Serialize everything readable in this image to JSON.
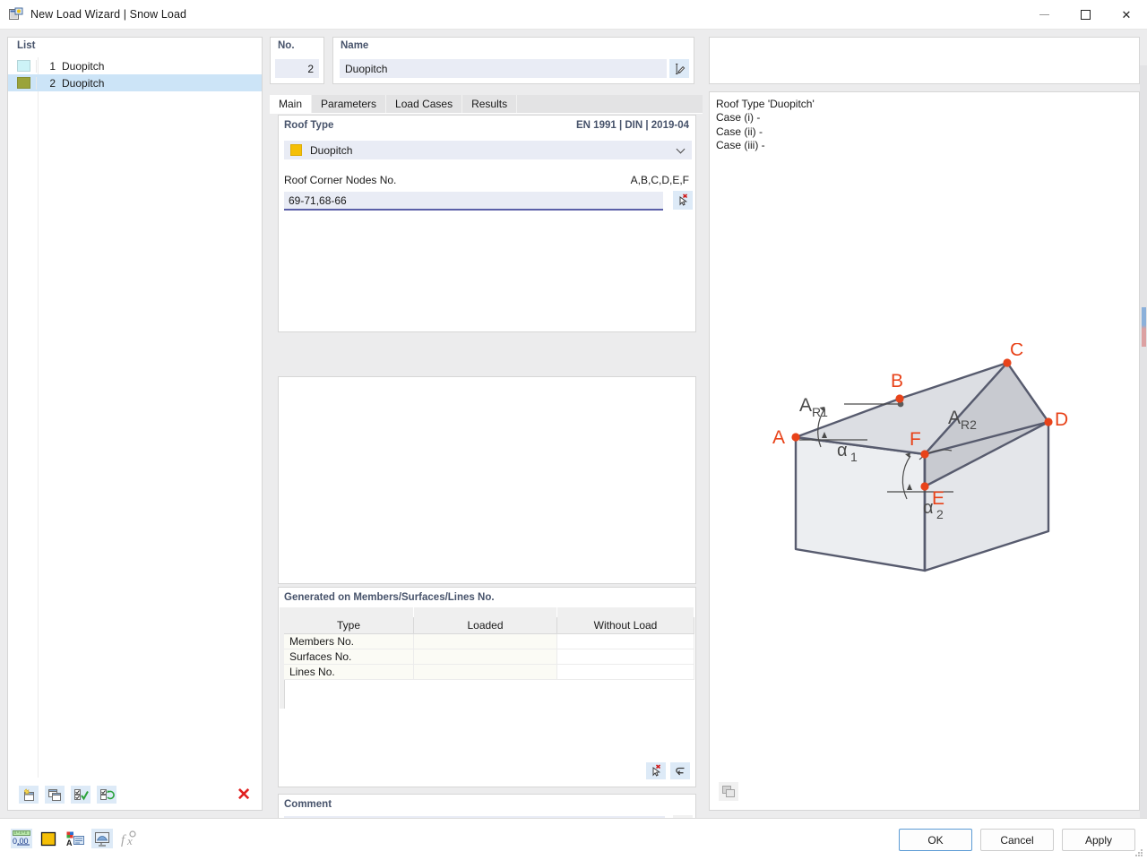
{
  "window": {
    "title": "New Load Wizard | Snow Load",
    "icon": "wizard-icon",
    "minimize": "—",
    "maximize": "□",
    "close": "✕"
  },
  "list": {
    "header": "List",
    "rows": [
      {
        "num": "1",
        "label": "Duopitch",
        "color": "#cdf3f7"
      },
      {
        "num": "2",
        "label": "Duopitch",
        "color": "#9aa33a",
        "selected": true
      }
    ],
    "toolbar": [
      {
        "name": "new-item-button",
        "icon": "new-window-icon"
      },
      {
        "name": "copy-item-button",
        "icon": "copy-window-icon"
      },
      {
        "name": "check-all-button",
        "icon": "checkbox-check-icon"
      },
      {
        "name": "invert-check-button",
        "icon": "checkbox-refresh-icon"
      },
      {
        "name": "delete-item-button",
        "icon": "red-x-icon",
        "glyph": "✕"
      }
    ]
  },
  "header": {
    "no_legend": "No.",
    "no_value": "2",
    "name_legend": "Name",
    "name_value": "Duopitch",
    "edit_button_icon": "edit-pencil-icon"
  },
  "tabs": [
    {
      "label": "Main",
      "active": true
    },
    {
      "label": "Parameters",
      "active": false
    },
    {
      "label": "Load Cases",
      "active": false
    },
    {
      "label": "Results",
      "active": false
    }
  ],
  "roof_type": {
    "legend": "Roof Type",
    "standard": "EN 1991 | DIN | 2019-04",
    "selected": "Duopitch",
    "swatch_color": "#f5bf06",
    "nodes_label": "Roof Corner Nodes No.",
    "nodes_hint": "A,B,C,D,E,F",
    "nodes_value": "69-71,68-66",
    "pick_button_icon": "select-cursor-icon"
  },
  "generated": {
    "legend": "Generated on Members/Surfaces/Lines No.",
    "columns": [
      "Type",
      "Loaded",
      "Without Load"
    ],
    "rows": [
      {
        "type": "Members No.",
        "loaded": "",
        "without_load": ""
      },
      {
        "type": "Surfaces No.",
        "loaded": "",
        "without_load": ""
      },
      {
        "type": "Lines No.",
        "loaded": "",
        "without_load": ""
      }
    ],
    "footer_buttons": [
      {
        "name": "select-cursor-button",
        "icon": "select-cursor-icon"
      },
      {
        "name": "reset-button",
        "icon": "undo-arrow-icon"
      }
    ]
  },
  "comment": {
    "legend": "Comment",
    "value": "",
    "button_icon": "comment-list-icon"
  },
  "right_panel": {
    "info_lines": [
      "Roof Type 'Duopitch'",
      "Case (i) -",
      "Case (ii) -",
      "Case (iii) -"
    ],
    "image_button_icon": "image-copy-icon",
    "diagram": {
      "title": "duopitch-roof-diagram",
      "node_labels": [
        "A",
        "B",
        "C",
        "D",
        "E",
        "F"
      ],
      "area_labels": [
        "A",
        "R1",
        "A",
        "R2"
      ],
      "area_label_1": "A",
      "area_sub_1": "R1",
      "area_label_2": "A",
      "area_sub_2": "R2",
      "angle_1": "α",
      "angle_1_sub": "1",
      "angle_2": "α",
      "angle_2_sub": "2",
      "node_color": "#e8431a",
      "edge_color": "#575b6e",
      "face_light": "#eceef1",
      "face_dark": "#c8cad0",
      "face_mid": "#dcdee3"
    }
  },
  "bottom_toolbar": [
    {
      "name": "units-button",
      "icon": "ruler-000-icon",
      "label": "0,00"
    },
    {
      "name": "color-button",
      "icon": "yellow-square-icon"
    },
    {
      "name": "display-props-button",
      "icon": "palette-panel-icon"
    },
    {
      "name": "view-button",
      "icon": "monitor-icon"
    },
    {
      "name": "formula-button",
      "icon": "fx-icon",
      "label": "fƒ"
    }
  ],
  "dialog_buttons": {
    "ok": "OK",
    "cancel": "Cancel",
    "apply": "Apply"
  }
}
